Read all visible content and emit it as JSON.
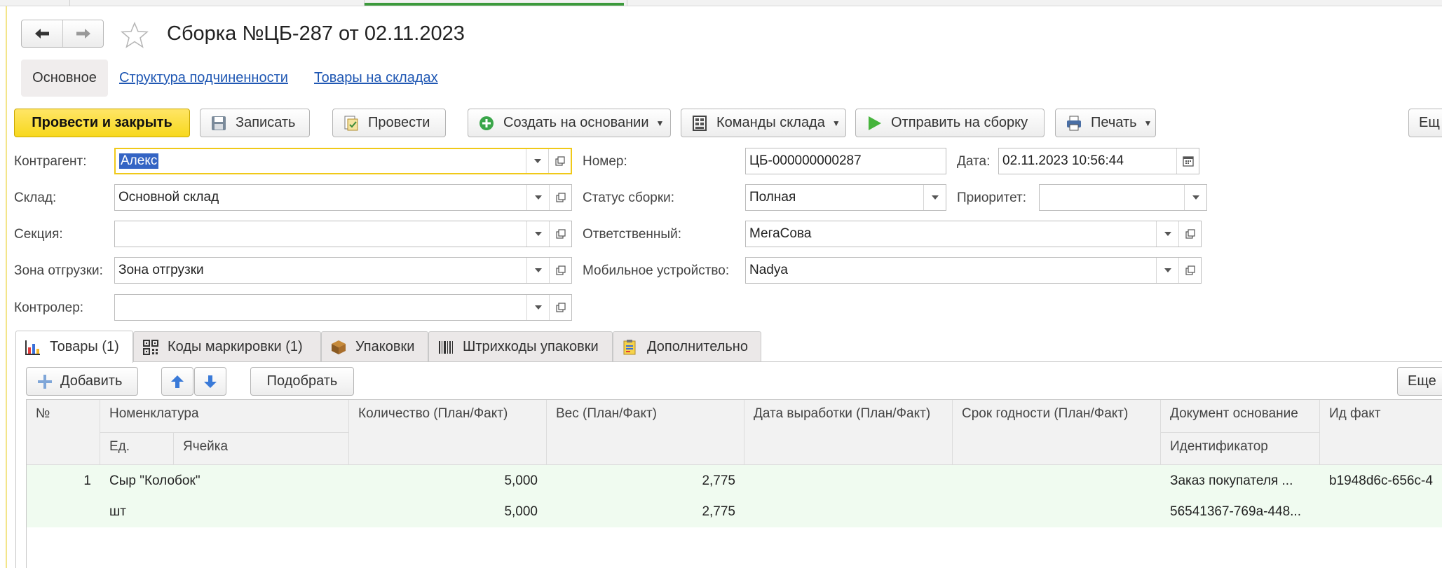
{
  "window": {
    "title": "Сборка №ЦБ-287 от 02.11.2023"
  },
  "sections": {
    "main": "Основное",
    "structure": "Структура подчиненности",
    "stock": "Товары на складах"
  },
  "toolbar": {
    "post_close": "Провести и закрыть",
    "save": "Записать",
    "post": "Провести",
    "create_based": "Создать на основании",
    "warehouse_cmds": "Команды склада",
    "send_assembly": "Отправить на сборку",
    "print": "Печать",
    "more": "Ещ"
  },
  "form": {
    "contractor_label": "Контрагент:",
    "contractor_value": "Алекс",
    "warehouse_label": "Склад:",
    "warehouse_value": "Основной склад",
    "section_label": "Секция:",
    "section_value": "",
    "zone_label": "Зона отгрузки:",
    "zone_value": "Зона отгрузки",
    "controller_label": "Контролер:",
    "controller_value": "",
    "number_label": "Номер:",
    "number_value": "ЦБ-000000000287",
    "date_label": "Дата:",
    "date_value": "02.11.2023 10:56:44",
    "status_label": "Статус сборки:",
    "status_value": "Полная",
    "priority_label": "Приоритет:",
    "priority_value": "",
    "responsible_label": "Ответственный:",
    "responsible_value": "МегаСова",
    "device_label": "Мобильное устройство:",
    "device_value": "Nadya"
  },
  "tabs": [
    {
      "label": "Товары (1)",
      "icon": "chart-icon"
    },
    {
      "label": "Коды маркировки  (1)",
      "icon": "qr-code-icon"
    },
    {
      "label": "Упаковки",
      "icon": "box-icon"
    },
    {
      "label": "Штрихкоды упаковки",
      "icon": "barcode-icon"
    },
    {
      "label": "Дополнительно",
      "icon": "clipboard-icon"
    }
  ],
  "table_toolbar": {
    "add": "Добавить",
    "pick": "Подобрать",
    "more": "Еще"
  },
  "table": {
    "headers": {
      "num": "№",
      "nomenclature": "Номенклатура",
      "unit": "Ед.",
      "cell": "Ячейка",
      "qty": "Количество (План/Факт)",
      "weight": "Вес (План/Факт)",
      "prod_date": "Дата выработки (План/Факт)",
      "expiry": "Срок годности  (План/Факт)",
      "doc_basis": "Документ основание",
      "identifier": "Идентификатор",
      "id_fact": "Ид факт"
    },
    "rows": [
      {
        "num": "1",
        "nomenclature": "Сыр \"Колобок\"",
        "unit": "шт",
        "qty_plan": "5,000",
        "qty_fact": "5,000",
        "weight_plan": "2,775",
        "weight_fact": "2,775",
        "doc_basis": "Заказ покупателя ...",
        "identifier": "56541367-769a-448...",
        "id_fact": "b1948d6c-656c-4"
      }
    ]
  },
  "colors": {
    "primary_button": "#f7d81d",
    "link": "#1f57b3",
    "row_highlight": "#f0fbf0",
    "selection": "#3464c4"
  }
}
